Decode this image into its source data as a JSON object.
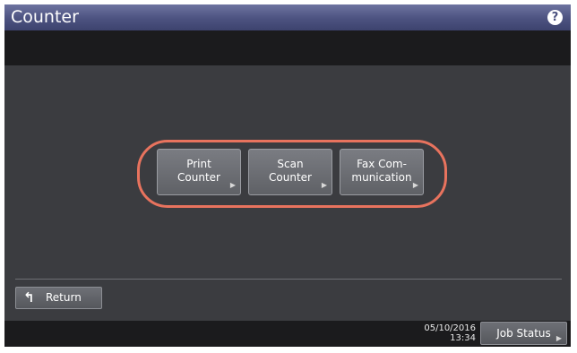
{
  "header": {
    "title": "Counter",
    "help_glyph": "?"
  },
  "buttons": [
    {
      "line1": "Print",
      "line2": "Counter",
      "icon": "triangle-right-icon"
    },
    {
      "line1": "Scan",
      "line2": "Counter",
      "icon": "triangle-right-icon"
    },
    {
      "line1": "Fax Com-",
      "line2": "munication",
      "icon": "triangle-right-icon"
    }
  ],
  "return_button": {
    "label": "Return",
    "icon": "return-arrow-icon"
  },
  "footer": {
    "date": "05/10/2016",
    "time": "13:34",
    "job_status_label": "Job Status"
  },
  "colors": {
    "title_bar": "#4c5280",
    "highlight": "#e8735e",
    "background": "#3b3c40"
  }
}
